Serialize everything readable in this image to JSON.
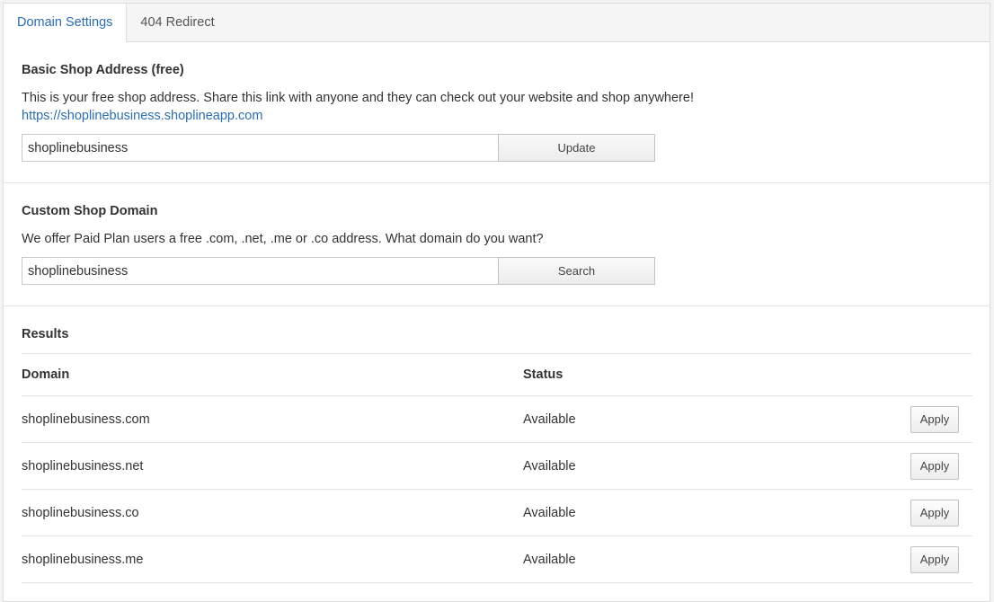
{
  "tabs": [
    {
      "label": "Domain Settings",
      "active": true
    },
    {
      "label": "404 Redirect",
      "active": false
    }
  ],
  "basic": {
    "title": "Basic Shop Address (free)",
    "description": "This is your free shop address. Share this link with anyone and they can check out your website and shop anywhere!",
    "link": "https://shoplinebusiness.shoplineapp.com",
    "input_value": "shoplinebusiness",
    "button_label": "Update"
  },
  "custom": {
    "title": "Custom Shop Domain",
    "description": "We offer Paid Plan users a free .com, .net, .me or .co address. What domain do you want?",
    "input_value": "shoplinebusiness",
    "button_label": "Search"
  },
  "results": {
    "title": "Results",
    "columns": {
      "domain": "Domain",
      "status": "Status"
    },
    "rows": [
      {
        "domain": "shoplinebusiness.com",
        "status": "Available",
        "action": "Apply"
      },
      {
        "domain": "shoplinebusiness.net",
        "status": "Available",
        "action": "Apply"
      },
      {
        "domain": "shoplinebusiness.co",
        "status": "Available",
        "action": "Apply"
      },
      {
        "domain": "shoplinebusiness.me",
        "status": "Available",
        "action": "Apply"
      }
    ]
  },
  "colors": {
    "link": "#2a6db3",
    "text": "#333333",
    "border": "#dcdcdc"
  }
}
